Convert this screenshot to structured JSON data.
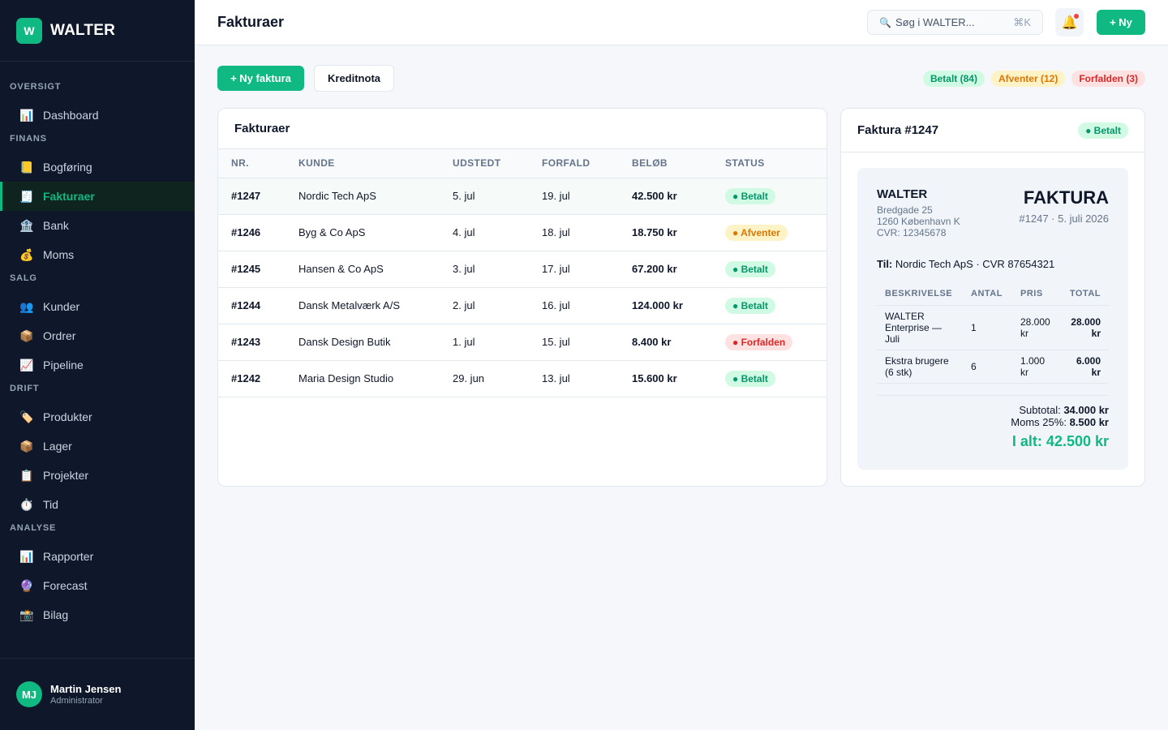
{
  "brand": {
    "logo_letter": "W",
    "name": "WALTER"
  },
  "sidebar": {
    "sections": [
      {
        "title": "OVERSIGT",
        "items": [
          {
            "icon": "📊",
            "icon_name": "dashboard-icon",
            "label": "Dashboard"
          }
        ]
      },
      {
        "title": "FINANS",
        "items": [
          {
            "icon": "📒",
            "icon_name": "ledger-icon",
            "label": "Bogføring"
          },
          {
            "icon": "🧾",
            "icon_name": "receipt-icon",
            "label": "Fakturaer",
            "active": true
          },
          {
            "icon": "🏦",
            "icon_name": "bank-icon",
            "label": "Bank"
          },
          {
            "icon": "💰",
            "icon_name": "money-bag-icon",
            "label": "Moms"
          }
        ]
      },
      {
        "title": "SALG",
        "items": [
          {
            "icon": "👥",
            "icon_name": "customers-icon",
            "label": "Kunder"
          },
          {
            "icon": "📦",
            "icon_name": "package-icon",
            "label": "Ordrer"
          },
          {
            "icon": "📈",
            "icon_name": "trend-up-icon",
            "label": "Pipeline"
          }
        ]
      },
      {
        "title": "DRIFT",
        "items": [
          {
            "icon": "🏷️",
            "icon_name": "tag-icon",
            "label": "Produkter"
          },
          {
            "icon": "📦",
            "icon_name": "package-icon",
            "label": "Lager"
          },
          {
            "icon": "📋",
            "icon_name": "clipboard-icon",
            "label": "Projekter"
          },
          {
            "icon": "⏱️",
            "icon_name": "stopwatch-icon",
            "label": "Tid"
          }
        ]
      },
      {
        "title": "ANALYSE",
        "items": [
          {
            "icon": "📊",
            "icon_name": "bar-chart-icon",
            "label": "Rapporter"
          },
          {
            "icon": "🔮",
            "icon_name": "crystal-ball-icon",
            "label": "Forecast"
          },
          {
            "icon": "📸",
            "icon_name": "camera-icon",
            "label": "Bilag"
          }
        ]
      }
    ]
  },
  "user": {
    "initials": "MJ",
    "name": "Martin Jensen",
    "role": "Administrator"
  },
  "topbar": {
    "title": "Fakturaer",
    "search_placeholder": "Søg i WALTER...",
    "search_shortcut": "⌘K",
    "new_button": "+ Ny"
  },
  "actions": {
    "new_invoice": "+ Ny faktura",
    "credit_note": "Kreditnota"
  },
  "status_pills": {
    "paid": "Betalt (84)",
    "pending": "Afventer (12)",
    "overdue": "Forfalden (3)"
  },
  "invoice_list": {
    "title": "Fakturaer",
    "columns": [
      "NR.",
      "KUNDE",
      "UDSTEDT",
      "FORFALD",
      "BELØB",
      "STATUS"
    ],
    "rows": [
      {
        "nr": "#1247",
        "customer": "Nordic Tech ApS",
        "issued": "5. jul",
        "due": "19. jul",
        "amount": "42.500 kr",
        "status": "● Betalt",
        "status_type": "paid",
        "selected": true
      },
      {
        "nr": "#1246",
        "customer": "Byg & Co ApS",
        "issued": "4. jul",
        "due": "18. jul",
        "amount": "18.750 kr",
        "status": "● Afventer",
        "status_type": "pending"
      },
      {
        "nr": "#1245",
        "customer": "Hansen & Co ApS",
        "issued": "3. jul",
        "due": "17. jul",
        "amount": "67.200 kr",
        "status": "● Betalt",
        "status_type": "paid"
      },
      {
        "nr": "#1244",
        "customer": "Dansk Metalværk A/S",
        "issued": "2. jul",
        "due": "16. jul",
        "amount": "124.000 kr",
        "status": "● Betalt",
        "status_type": "paid"
      },
      {
        "nr": "#1243",
        "customer": "Dansk Design Butik",
        "issued": "1. jul",
        "due": "15. jul",
        "amount": "8.400 kr",
        "status": "● Forfalden",
        "status_type": "overdue"
      },
      {
        "nr": "#1242",
        "customer": "Maria Design Studio",
        "issued": "29. jun",
        "due": "13. jul",
        "amount": "15.600 kr",
        "status": "● Betalt",
        "status_type": "paid"
      }
    ]
  },
  "detail": {
    "title": "Faktura #1247",
    "status": "● Betalt",
    "company": {
      "name": "WALTER",
      "address1": "Bredgade 25",
      "address2": "1260 København K",
      "cvr": "CVR: 12345678"
    },
    "doc_title": "FAKTURA",
    "doc_meta": "#1247 · 5. juli 2026",
    "to_label": "Til:",
    "to_value": "Nordic Tech ApS · CVR 87654321",
    "line_columns": [
      "BESKRIVELSE",
      "ANTAL",
      "PRIS",
      "TOTAL"
    ],
    "lines": [
      {
        "desc": "WALTER Enterprise — Juli",
        "qty": "1",
        "price": "28.000 kr",
        "total": "28.000 kr"
      },
      {
        "desc": "Ekstra brugere (6 stk)",
        "qty": "6",
        "price": "1.000 kr",
        "total": "6.000 kr"
      }
    ],
    "subtotal_label": "Subtotal:",
    "subtotal_value": "34.000 kr",
    "vat_label": "Moms 25%:",
    "vat_value": "8.500 kr",
    "grand_total": "I alt: 42.500 kr"
  },
  "colors": {
    "accent": "#10b981",
    "sidebar_bg": "#0f172a",
    "paid": "#059669",
    "pending": "#d97706",
    "overdue": "#dc2626"
  }
}
